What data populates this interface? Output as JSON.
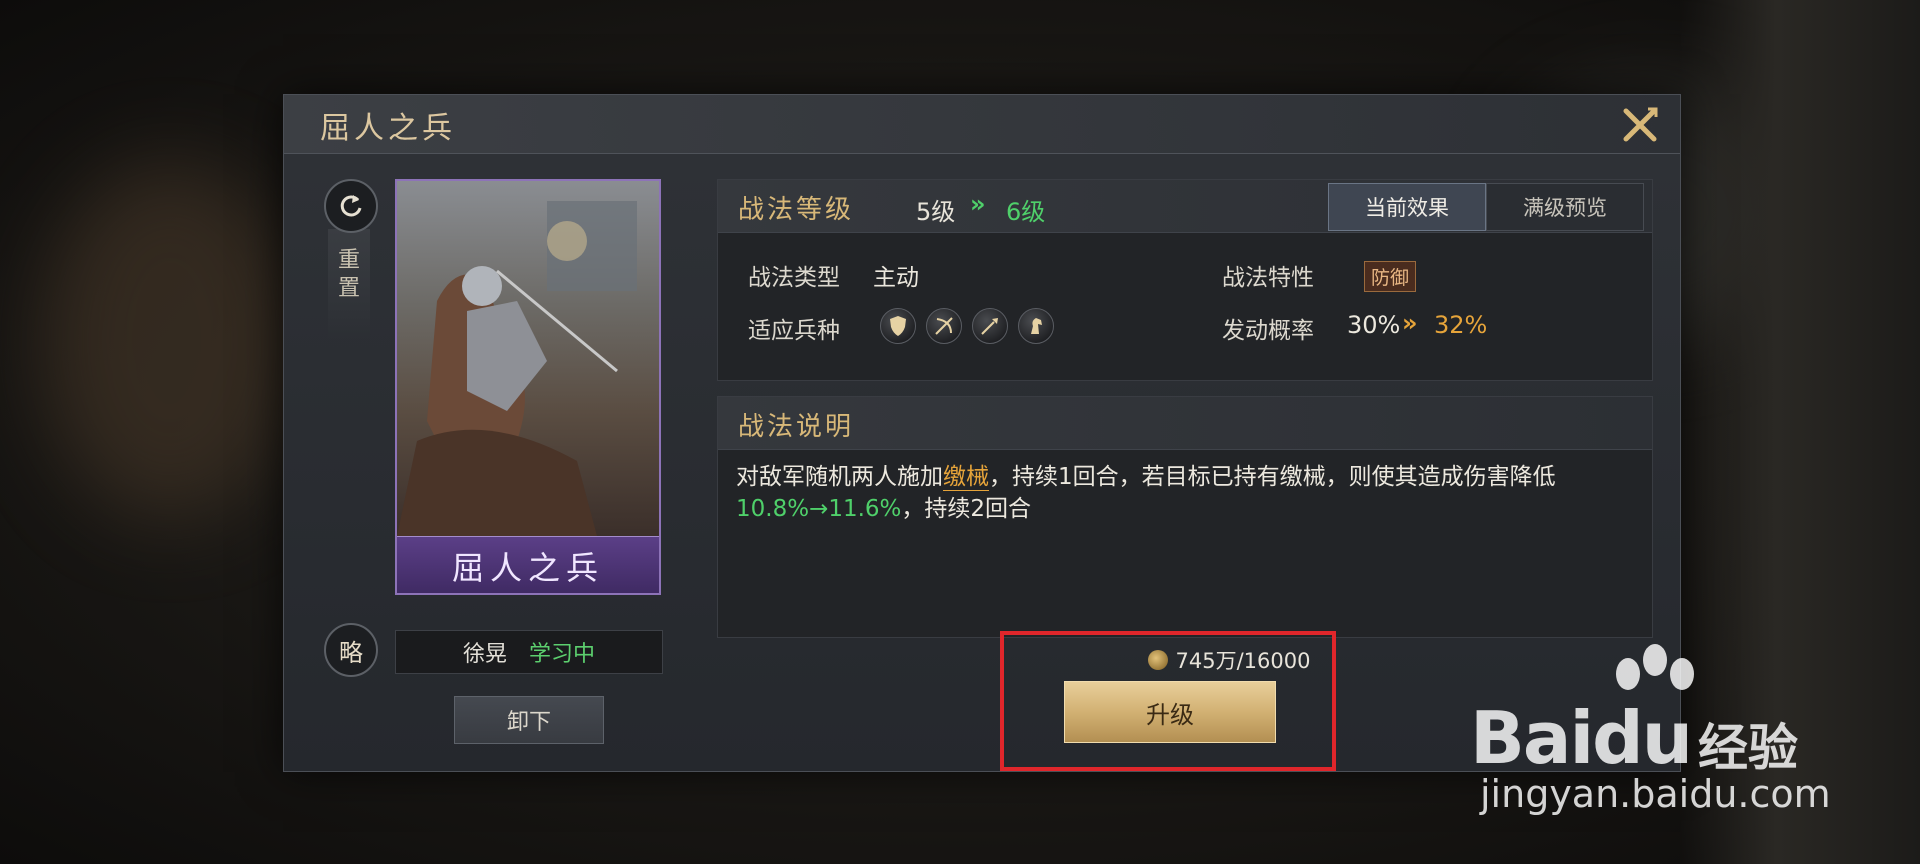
{
  "dialog": {
    "title": "屈人之兵"
  },
  "left": {
    "reset_label": "重置",
    "card_name": "屈人之兵",
    "type_badge": "略",
    "learner_name": "徐晃",
    "learner_status": "学习中",
    "unload_label": "卸下"
  },
  "level": {
    "title": "战法等级",
    "from": "5级",
    "arrow": "»",
    "to": "6级",
    "tabs": [
      "当前效果",
      "满级预览"
    ]
  },
  "props": {
    "type_label": "战法类型",
    "type_value": "主动",
    "trait_label": "战法特性",
    "trait_value": "防御",
    "troops_label": "适应兵种",
    "troop_icons": [
      "shield-icon",
      "bow-icon",
      "spear-icon",
      "horse-icon"
    ],
    "rate_label": "发动概率",
    "rate_from": "30%",
    "rate_arrow": "»",
    "rate_to": "32%"
  },
  "desc": {
    "title": "战法说明",
    "part1": "对敌军随机两人施加",
    "keyword": "缴械",
    "part2": "，持续1回合，若目标已持有缴械，则使其造成伤害降低",
    "value": "10.8%→11.6%",
    "part3": "，持续2回合"
  },
  "upgrade": {
    "cost": "745万/16000",
    "button_label": "升级"
  },
  "watermark": {
    "logo": "Bai",
    "logo2": "du",
    "sub": "经验",
    "url": "jingyan.baidu.com"
  },
  "colors": {
    "accent_gold": "#d8b878",
    "green": "#4fd06a",
    "orange": "#e6a43a",
    "highlight_red": "#e0262b"
  }
}
